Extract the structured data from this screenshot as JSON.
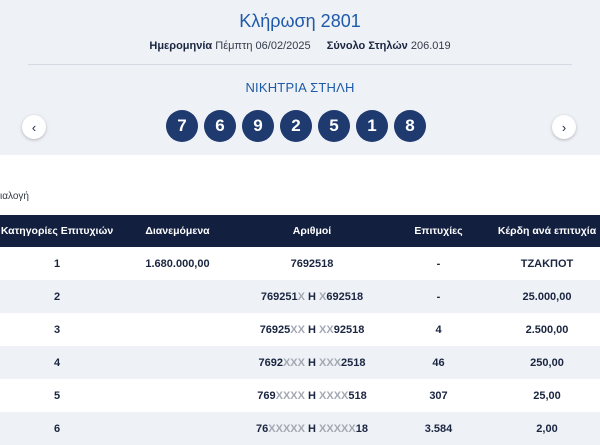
{
  "header": {
    "draw_title": "Κλήρωση 2801",
    "date_label": "Ημερομηνία",
    "date_value": "Πέμπτη 06/02/2025",
    "total_label": "Σύνολο Στηλών",
    "total_value": "206.019"
  },
  "winning": {
    "title": "ΝΙΚΗΤΡΙΑ ΣΤΗΛΗ",
    "numbers": [
      "7",
      "6",
      "9",
      "2",
      "5",
      "1",
      "8"
    ],
    "prev_icon": "‹",
    "next_icon": "›"
  },
  "section_label": "ιαλογή",
  "table": {
    "headers": [
      "Κατηγορίες Επιτυχιών",
      "Διανεμόμενα",
      "Αριθμοί",
      "Επιτυχίες",
      "Κέρδη ανά επιτυχία"
    ],
    "rows": [
      {
        "category": "1",
        "distributed": "1.680.000,00",
        "numbers": [
          [
            "7692518",
            "n"
          ]
        ],
        "winners": "-",
        "prize": "ΤΖΑΚΠΟΤ"
      },
      {
        "category": "2",
        "distributed": "",
        "numbers": [
          [
            "769251",
            "n"
          ],
          [
            "X",
            "x"
          ],
          [
            " Η ",
            "n"
          ],
          [
            "X",
            "x"
          ],
          [
            "692518",
            "n"
          ]
        ],
        "winners": "-",
        "prize": "25.000,00"
      },
      {
        "category": "3",
        "distributed": "",
        "numbers": [
          [
            "76925",
            "n"
          ],
          [
            "XX",
            "x"
          ],
          [
            " Η ",
            "n"
          ],
          [
            "XX",
            "x"
          ],
          [
            "92518",
            "n"
          ]
        ],
        "winners": "4",
        "prize": "2.500,00"
      },
      {
        "category": "4",
        "distributed": "",
        "numbers": [
          [
            "7692",
            "n"
          ],
          [
            "XXX",
            "x"
          ],
          [
            " Η ",
            "n"
          ],
          [
            "XXX",
            "x"
          ],
          [
            "2518",
            "n"
          ]
        ],
        "winners": "46",
        "prize": "250,00"
      },
      {
        "category": "5",
        "distributed": "",
        "numbers": [
          [
            "769",
            "n"
          ],
          [
            "XXXX",
            "x"
          ],
          [
            " Η ",
            "n"
          ],
          [
            "XXXX",
            "x"
          ],
          [
            "518",
            "n"
          ]
        ],
        "winners": "307",
        "prize": "25,00"
      },
      {
        "category": "6",
        "distributed": "",
        "numbers": [
          [
            "76",
            "n"
          ],
          [
            "XXXXX",
            "x"
          ],
          [
            " Η ",
            "n"
          ],
          [
            "XXXXX",
            "x"
          ],
          [
            "18",
            "n"
          ]
        ],
        "winners": "3.584",
        "prize": "2,00"
      }
    ]
  },
  "colors": {
    "accent": "#1e5aa8",
    "ball": "#1e3a6e",
    "table_header": "#121f3f",
    "masked_digit": "#a3a8b2"
  }
}
